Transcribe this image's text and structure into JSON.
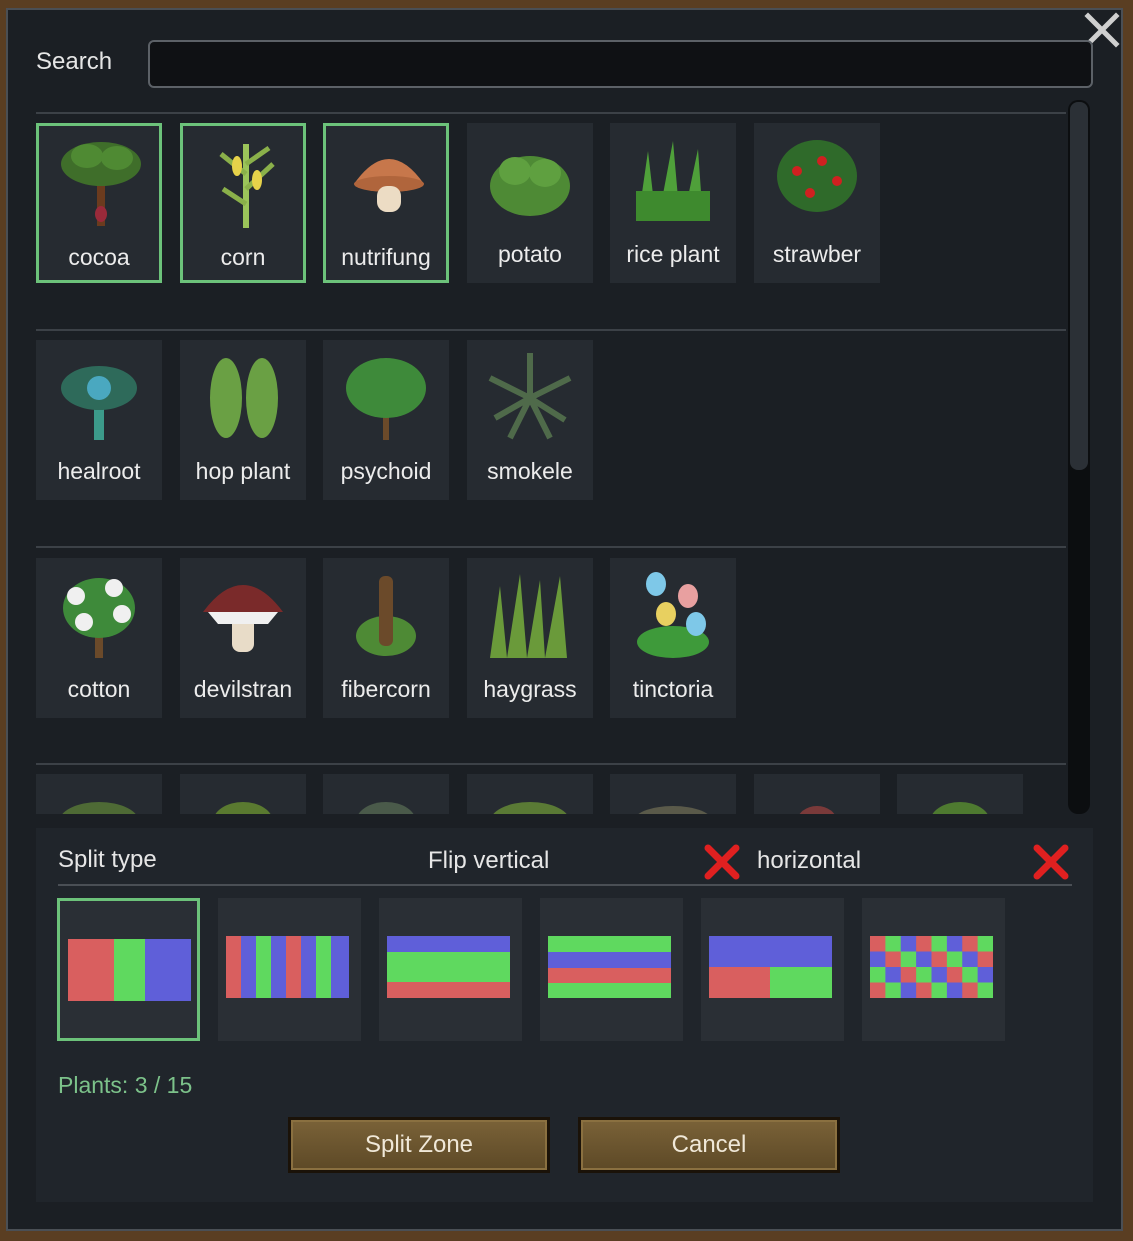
{
  "search": {
    "label": "Search",
    "value": "",
    "placeholder": ""
  },
  "groups": [
    {
      "plants": [
        {
          "label": "cocoa",
          "icon": "cocoa-tree-icon",
          "selected": true
        },
        {
          "label": "corn",
          "icon": "corn-plant-icon",
          "selected": true
        },
        {
          "label": "nutrifung",
          "icon": "mushroom-icon",
          "selected": true
        },
        {
          "label": "potato",
          "icon": "potato-plant-icon",
          "selected": false
        },
        {
          "label": "rice plant",
          "icon": "rice-plant-icon",
          "selected": false
        },
        {
          "label": "strawber",
          "icon": "strawberry-bush-icon",
          "selected": false
        }
      ]
    },
    {
      "plants": [
        {
          "label": "healroot",
          "icon": "healroot-icon",
          "selected": false
        },
        {
          "label": "hop plant",
          "icon": "hop-plant-icon",
          "selected": false
        },
        {
          "label": "psychoid",
          "icon": "psychoid-plant-icon",
          "selected": false
        },
        {
          "label": "smokele",
          "icon": "smokeleaf-icon",
          "selected": false
        }
      ]
    },
    {
      "plants": [
        {
          "label": "cotton",
          "icon": "cotton-plant-icon",
          "selected": false
        },
        {
          "label": "devilstran",
          "icon": "devilstrand-mushroom-icon",
          "selected": false
        },
        {
          "label": "fibercorn",
          "icon": "fibercorn-icon",
          "selected": false
        },
        {
          "label": "haygrass",
          "icon": "haygrass-icon",
          "selected": false
        },
        {
          "label": "tinctoria",
          "icon": "tinctoria-flower-icon",
          "selected": false
        }
      ]
    }
  ],
  "split": {
    "type_label": "Split type",
    "flip_vertical_label": "Flip vertical",
    "flip_vertical_enabled": false,
    "horizontal_label": "horizontal",
    "horizontal_enabled": false,
    "options": [
      "split-two-vertical",
      "split-stripes-vertical",
      "split-two-horizontal",
      "split-stripes-horizontal",
      "split-quadrants",
      "split-checker"
    ],
    "selected_index": 0,
    "colors": {
      "red": "#d95f5f",
      "green": "#5fd95f",
      "blue": "#5f5fd9"
    }
  },
  "plants_count": "Plants: 3 / 15",
  "buttons": {
    "split_zone": "Split Zone",
    "cancel": "Cancel"
  },
  "colors": {
    "selected_border": "#6cc27a",
    "x_red": "#e02020"
  }
}
